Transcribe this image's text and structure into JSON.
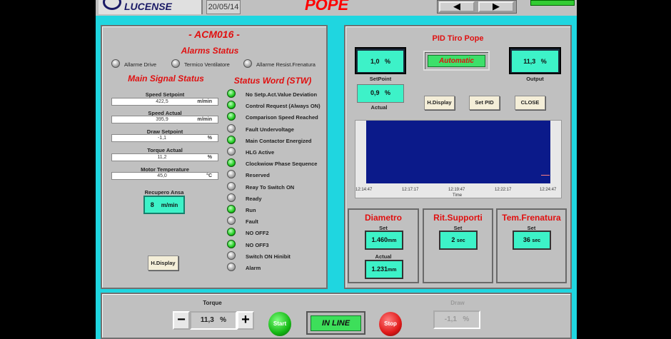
{
  "header": {
    "logo_text": "LUCENSE",
    "date": "20/05/14",
    "title": "POPE",
    "nav_prev": "◀",
    "nav_next": "▶"
  },
  "drive": {
    "title": "- ACM016 -",
    "alarms_title": "Alarms Status",
    "alarms": [
      {
        "label": "Allarme Drive",
        "state": "off"
      },
      {
        "label": "Termico Ventilatore",
        "state": "off"
      },
      {
        "label": "Allarme Resist.Frenatura",
        "state": "off"
      }
    ],
    "main_signal_title": "Main Signal Status",
    "signals": [
      {
        "label": "Speed Setpoint",
        "value": "422,5",
        "unit": "m/min"
      },
      {
        "label": "Speed Actual",
        "value": "395,9",
        "unit": "m/min"
      },
      {
        "label": "Draw Setpoint",
        "value": "-1,1",
        "unit": "%"
      },
      {
        "label": "Torque Actual",
        "value": "11,2",
        "unit": "%"
      },
      {
        "label": "Motor Temperature",
        "value": "45,0",
        "unit": "°C"
      }
    ],
    "recupero_label": "Recupero Ansa",
    "recupero_value": "8",
    "recupero_unit": "m/min",
    "hdisplay_label": "H.Display",
    "stw_title": "Status Word (STW)",
    "stw": [
      {
        "label": "No Setp.Act.Value Deviation",
        "on": true
      },
      {
        "label": "Control Request (Always ON)",
        "on": true
      },
      {
        "label": "Comparison Speed Reached",
        "on": true
      },
      {
        "label": "Fault Undervoltage",
        "on": false
      },
      {
        "label": "Main Contactor Energized",
        "on": true
      },
      {
        "label": "HLG Active",
        "on": false
      },
      {
        "label": "Clockwiow Phase Sequence",
        "on": true
      },
      {
        "label": "Reserved",
        "on": false
      },
      {
        "label": "Reay To Switch ON",
        "on": false
      },
      {
        "label": "Ready",
        "on": false
      },
      {
        "label": "Run",
        "on": true
      },
      {
        "label": "Fault",
        "on": false
      },
      {
        "label": "NO OFF2",
        "on": true
      },
      {
        "label": "NO OFF3",
        "on": true
      },
      {
        "label": "Switch ON Hinibit",
        "on": false
      },
      {
        "label": "Alarm",
        "on": false
      }
    ]
  },
  "pid": {
    "title": "PID Tiro Pope",
    "setpoint_value": "1,0",
    "setpoint_unit": "%",
    "setpoint_label": "SetPoint",
    "mode": "Automatic",
    "output_value": "11,3",
    "output_unit": "%",
    "output_label": "Output",
    "actual_value": "0,9",
    "actual_unit": "%",
    "actual_label": "Actual",
    "btn_hdisplay": "H.Display",
    "btn_setpid": "Set PID",
    "btn_close": "CLOSE",
    "chart": {
      "times": [
        "12:14:47",
        "12:17:17",
        "12:19:47",
        "12:22:17",
        "12:24:47"
      ],
      "xlabel": "Time"
    }
  },
  "boxes": {
    "diametro": {
      "title": "Diametro",
      "set_label": "Set",
      "set_value": "1.460",
      "set_unit": "mm",
      "actual_label": "Actual",
      "actual_value": "1.231",
      "actual_unit": "mm"
    },
    "ritsupporti": {
      "title": "Rit.Supporti",
      "set_label": "Set",
      "set_value": "2",
      "set_unit": "sec"
    },
    "temfrenatura": {
      "title": "Tem.Frenatura",
      "set_label": "Set",
      "set_value": "36",
      "set_unit": "sec"
    }
  },
  "bottom": {
    "torque_label": "Torque",
    "torque_value": "11,3",
    "torque_unit": "%",
    "minus": "−",
    "plus": "+",
    "start_label": "Start",
    "inline_label": "IN LINE",
    "stop_label": "Stop",
    "draw_label": "Draw",
    "draw_value": "-1,1",
    "draw_unit": "%"
  },
  "colors": {
    "background": "#1fd6e0",
    "panel": "#c0c0c0",
    "title_red": "#e01010",
    "value_box": "#3df2c8",
    "chart_plot": "#0b1a8a",
    "led_on": "#22cc22"
  }
}
